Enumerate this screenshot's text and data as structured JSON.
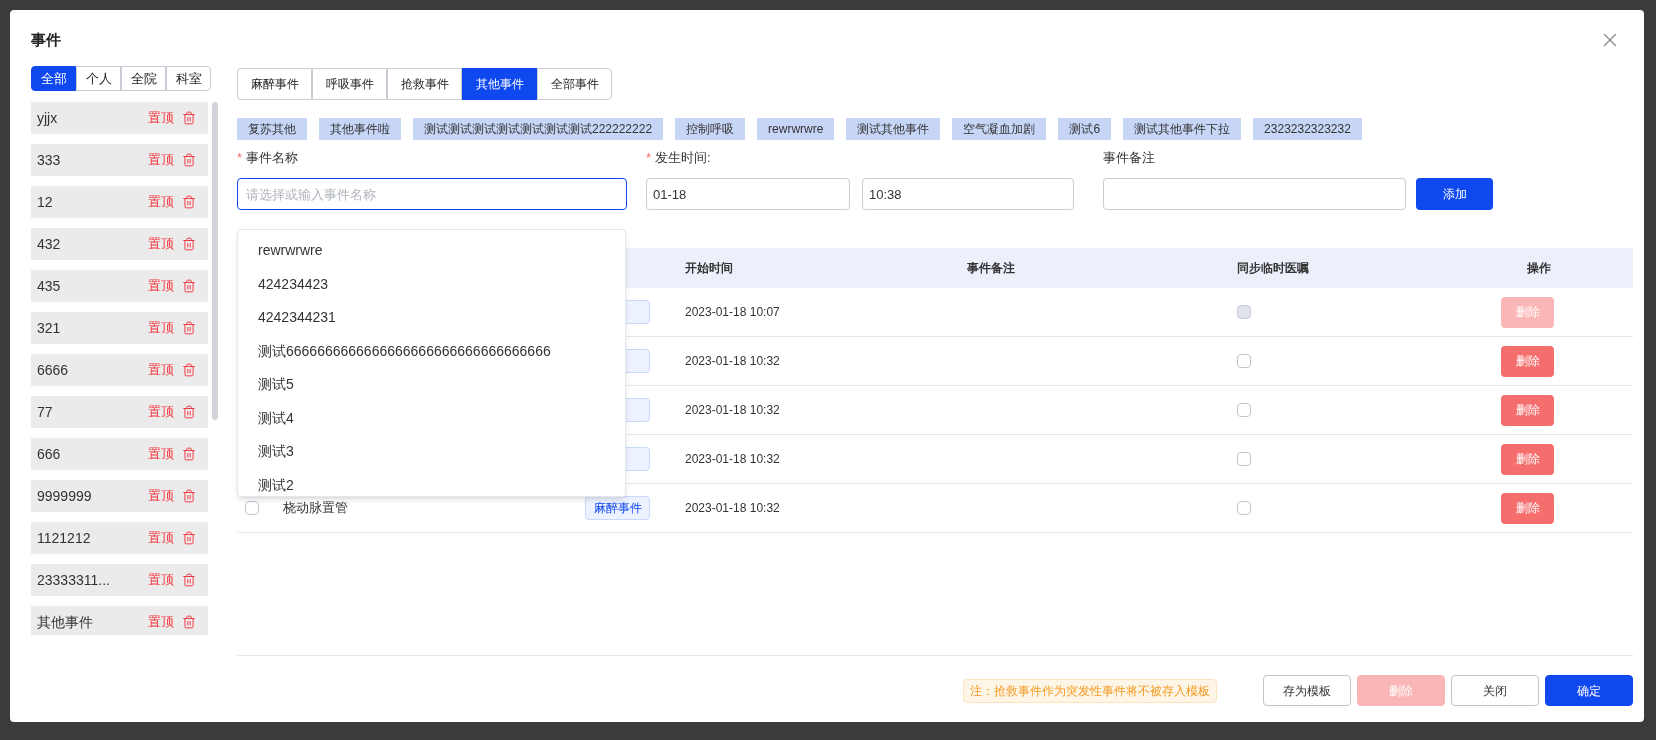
{
  "dialog": {
    "title": "事件"
  },
  "scope_tabs": [
    {
      "label": "全部",
      "selected": true
    },
    {
      "label": "个人",
      "selected": false
    },
    {
      "label": "全院",
      "selected": false
    },
    {
      "label": "科室",
      "selected": false
    }
  ],
  "templates": [
    {
      "name": "yjjx",
      "pin": "置顶"
    },
    {
      "name": "333",
      "pin": "置顶"
    },
    {
      "name": "12",
      "pin": "置顶"
    },
    {
      "name": "432",
      "pin": "置顶"
    },
    {
      "name": "435",
      "pin": "置顶"
    },
    {
      "name": "321",
      "pin": "置顶"
    },
    {
      "name": "6666",
      "pin": "置顶"
    },
    {
      "name": "77",
      "pin": "置顶"
    },
    {
      "name": "666",
      "pin": "置顶"
    },
    {
      "name": "9999999",
      "pin": "置顶"
    },
    {
      "name": "1121212",
      "pin": "置顶"
    },
    {
      "name": "23333311...",
      "pin": "置顶"
    },
    {
      "name": "其他事件",
      "pin": "置顶"
    }
  ],
  "category_tabs": [
    {
      "label": "麻醉事件",
      "selected": false
    },
    {
      "label": "呼吸事件",
      "selected": false
    },
    {
      "label": "抢救事件",
      "selected": false
    },
    {
      "label": "其他事件",
      "selected": true
    },
    {
      "label": "全部事件",
      "selected": false
    }
  ],
  "quick_tags": [
    "复苏其他",
    "其他事件啦",
    "测试测试测试测试测试测试测试222222222",
    "控制呼吸",
    "rewrwrwre",
    "测试其他事件",
    "空气凝血加剧",
    "测试6",
    "测试其他事件下拉",
    "2323232323232"
  ],
  "name_field": {
    "label": "事件名称",
    "required_mark": "*",
    "placeholder": "请选择或输入事件名称"
  },
  "time_field": {
    "label": "发生时间:",
    "required_mark": "*",
    "date": "01-18",
    "time": "10:38"
  },
  "note_field": {
    "label": "事件备注"
  },
  "add_button": "添加",
  "suggestions": [
    "rewrwrwre",
    "424234423",
    "4242344231",
    "测试6666666666666666666666666666666666",
    "测试5",
    "测试4",
    "测试3",
    "测试2"
  ],
  "table": {
    "columns": [
      "开始时间",
      "事件备注",
      "同步临时医嘱",
      "操作"
    ],
    "rows": [
      {
        "time": "2023-01-18 10:07",
        "sync_disabled": true,
        "delete": "删除",
        "delete_disabled": true
      },
      {
        "time": "2023-01-18 10:32",
        "sync_disabled": false,
        "delete": "删除",
        "delete_disabled": false
      },
      {
        "time": "2023-01-18 10:32",
        "sync_disabled": false,
        "delete": "删除",
        "delete_disabled": false
      },
      {
        "time": "2023-01-18 10:32",
        "sync_disabled": false,
        "delete": "删除",
        "delete_disabled": false
      },
      {
        "checked": false,
        "name": "桡动脉置管",
        "type": "麻醉事件",
        "time": "2023-01-18 10:32",
        "sync_disabled": false,
        "delete": "删除",
        "delete_disabled": false
      }
    ]
  },
  "footer": {
    "note": "注：抢救事件作为突发性事件将不被存入模板",
    "buttons": [
      {
        "label": "存为模板",
        "kind": "outline"
      },
      {
        "label": "删除",
        "kind": "danger-disabled"
      },
      {
        "label": "关闭",
        "kind": "outline"
      },
      {
        "label": "确定",
        "kind": "primary"
      }
    ]
  }
}
